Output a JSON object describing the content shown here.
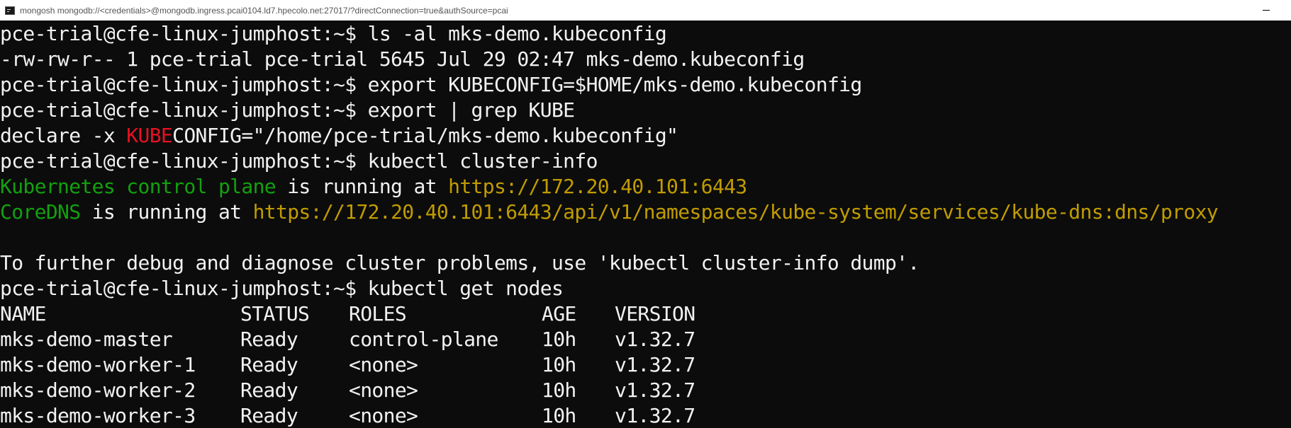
{
  "window": {
    "title": "mongosh mongodb://<credentials>@mongodb.ingress.pcai0104.ld7.hpecolo.net:27017/?directConnection=true&authSource=pcai",
    "icon": "console-icon"
  },
  "terminal": {
    "prompt": "pce-trial@cfe-linux-jumphost:~$",
    "cmd_ls": " ls -al mks-demo.kubeconfig",
    "ls_output": "-rw-rw-r-- 1 pce-trial pce-trial 5645 Jul 29 02:47 mks-demo.kubeconfig",
    "cmd_export_set": " export KUBECONFIG=$HOME/mks-demo.kubeconfig",
    "cmd_export_grep": " export | grep KUBE",
    "declare_prefix": "declare -x ",
    "declare_match": "KUBE",
    "declare_suffix": "CONFIG=\"/home/pce-trial/mks-demo.kubeconfig\"",
    "cmd_cluster_info": " kubectl cluster-info",
    "cp_label": "Kubernetes control plane",
    "cp_mid": " is running at ",
    "cp_url": "https://172.20.40.101:6443",
    "dns_label": "CoreDNS",
    "dns_mid": " is running at ",
    "dns_url": "https://172.20.40.101:6443/api/v1/namespaces/kube-system/services/kube-dns:dns/proxy",
    "debug_hint": "To further debug and diagnose cluster problems, use 'kubectl cluster-info dump'.",
    "cmd_get_nodes": " kubectl get nodes"
  },
  "nodes_table": {
    "headers": [
      "NAME",
      "STATUS",
      "ROLES",
      "AGE",
      "VERSION"
    ],
    "rows": [
      [
        "mks-demo-master",
        "Ready",
        "control-plane",
        "10h",
        "v1.32.7"
      ],
      [
        "mks-demo-worker-1",
        "Ready",
        "<none>",
        "10h",
        "v1.32.7"
      ],
      [
        "mks-demo-worker-2",
        "Ready",
        "<none>",
        "10h",
        "v1.32.7"
      ],
      [
        "mks-demo-worker-3",
        "Ready",
        "<none>",
        "10h",
        "v1.32.7"
      ]
    ]
  },
  "colors": {
    "background": "#0c0c0c",
    "foreground": "#f2f2f2",
    "green": "#13a10e",
    "url": "#c19c00",
    "match_red": "#e81123"
  }
}
